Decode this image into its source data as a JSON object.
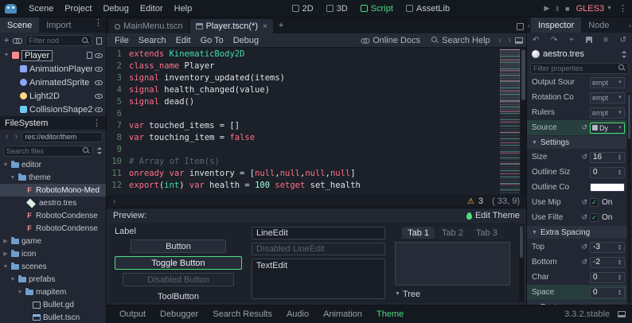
{
  "app": {
    "renderer": "GLES3",
    "version": "3.3.2.stable"
  },
  "colors": {
    "accent": "#4ade80",
    "warning": "#ffd153",
    "renderer_text": "#ff7e8d",
    "syntax": {
      "keyword": "#ff7085",
      "base_type": "#42ddb0",
      "number": "#a1ffe0",
      "comment": "#5b6574",
      "text": "#dfe3ea"
    }
  },
  "icons": {
    "dots_menu": "⋮",
    "add": "+",
    "chevron_left": "‹",
    "chevron_right": "›",
    "expander_open": "▼",
    "expander_closed": "▶",
    "dropdown_caret": "▼",
    "close": "×",
    "warning": "⚠",
    "check": "✓",
    "revert": "↺",
    "history_back": "↶",
    "history_forward": "↷",
    "menu": "≡",
    "play": "▶",
    "pause": "‖",
    "stop": "■",
    "spin_up": "▲",
    "spin_down": "▼"
  },
  "topbar": {
    "menus": [
      "Scene",
      "Project",
      "Debug",
      "Editor",
      "Help"
    ],
    "workspaces": [
      {
        "label": "2D",
        "active": false
      },
      {
        "label": "3D",
        "active": false
      },
      {
        "label": "Script",
        "active": true
      },
      {
        "label": "AssetLib",
        "active": false
      }
    ]
  },
  "scene_dock": {
    "tabs": [
      {
        "label": "Scene",
        "active": true
      },
      {
        "label": "Import",
        "active": false
      }
    ],
    "filter_placeholder": "Filter nod",
    "nodes": [
      {
        "name": "Player",
        "type": "kinematic-body2d",
        "color": "#fc8c8c",
        "indent": 0,
        "expander": true,
        "selected": true,
        "has_script": true,
        "eye": true,
        "round": false
      },
      {
        "name": "AnimationPlayer",
        "type": "animation-player",
        "color": "#8da5f3",
        "indent": 1,
        "expander": false,
        "selected": false,
        "has_script": false,
        "eye": true,
        "round": false
      },
      {
        "name": "AnimatedSprite",
        "type": "animated-sprite",
        "color": "#8da5f3",
        "indent": 1,
        "expander": false,
        "selected": false,
        "has_script": false,
        "eye": true,
        "round": true
      },
      {
        "name": "Light2D",
        "type": "light2d",
        "color": "#ffd97f",
        "indent": 1,
        "expander": false,
        "selected": false,
        "has_script": false,
        "eye": true,
        "round": true
      },
      {
        "name": "CollisionShape2D",
        "type": "collision-shape2d",
        "color": "#6fc9f0",
        "indent": 1,
        "expander": false,
        "selected": false,
        "has_script": false,
        "eye": true,
        "round": false
      }
    ]
  },
  "filesystem": {
    "title": "FileSystem",
    "path": "res://editor/them",
    "search_placeholder": "Search files",
    "items": [
      {
        "label": "editor",
        "icon": "folder",
        "expander": "open",
        "indent": 0,
        "selected": false
      },
      {
        "label": "theme",
        "icon": "folder",
        "expander": "open",
        "indent": 1,
        "selected": false
      },
      {
        "label": "RobotoMono-Med",
        "icon": "font",
        "expander": "",
        "indent": 2,
        "selected": true
      },
      {
        "label": "aestro.tres",
        "icon": "resource",
        "expander": "",
        "indent": 2,
        "selected": false
      },
      {
        "label": "RobotoCondense",
        "icon": "font",
        "expander": "",
        "indent": 2,
        "selected": false
      },
      {
        "label": "RobotoCondense",
        "icon": "font",
        "expander": "",
        "indent": 2,
        "selected": false
      },
      {
        "label": "game",
        "icon": "folder",
        "expander": "closed",
        "indent": 0,
        "selected": false
      },
      {
        "label": "icon",
        "icon": "folder",
        "expander": "closed",
        "indent": 0,
        "selected": false
      },
      {
        "label": "scenes",
        "icon": "folder",
        "expander": "open",
        "indent": 0,
        "selected": false
      },
      {
        "label": "prefabs",
        "icon": "folder",
        "expander": "open",
        "indent": 1,
        "selected": false
      },
      {
        "label": "mapitem",
        "icon": "folder",
        "expander": "open",
        "indent": 2,
        "selected": false
      },
      {
        "label": "Bullet.gd",
        "icon": "script",
        "expander": "",
        "indent": 3,
        "selected": false
      },
      {
        "label": "Bullet.tscn",
        "icon": "scene",
        "expander": "",
        "indent": 3,
        "selected": false
      }
    ]
  },
  "scene_tabs": {
    "tabs": [
      {
        "label": "MainMenu.tscn",
        "active": false
      },
      {
        "label": "Player.tscn(*)",
        "active": true
      }
    ]
  },
  "script_editor": {
    "menus": [
      "File",
      "Search",
      "Edit",
      "Go To",
      "Debug"
    ],
    "links": [
      {
        "label": "Online Docs"
      },
      {
        "label": "Search Help"
      }
    ],
    "status": {
      "warnings": "3",
      "caret": "( 33, 9)"
    },
    "code": [
      {
        "n": "1",
        "t": [
          [
            "k",
            "extends"
          ],
          [
            "p",
            " "
          ],
          [
            "c",
            "KinematicBody2D"
          ]
        ]
      },
      {
        "n": "2",
        "t": [
          [
            "k",
            "class_name"
          ],
          [
            "p",
            " Player"
          ]
        ]
      },
      {
        "n": "3",
        "t": [
          [
            "k",
            "signal"
          ],
          [
            "p",
            " inventory_updated(items)"
          ]
        ]
      },
      {
        "n": "4",
        "t": [
          [
            "k",
            "signal"
          ],
          [
            "p",
            " health_changed(value)"
          ]
        ]
      },
      {
        "n": "5",
        "t": [
          [
            "k",
            "signal"
          ],
          [
            "p",
            " dead()"
          ]
        ]
      },
      {
        "n": "6",
        "t": []
      },
      {
        "n": "7",
        "t": [
          [
            "k",
            "var"
          ],
          [
            "p",
            " touched_items = []"
          ]
        ]
      },
      {
        "n": "8",
        "t": [
          [
            "k",
            "var"
          ],
          [
            "p",
            " touching_item = "
          ],
          [
            "k",
            "false"
          ]
        ]
      },
      {
        "n": "9",
        "t": []
      },
      {
        "n": "10",
        "t": [
          [
            "m",
            "# Array of Item(s)"
          ]
        ]
      },
      {
        "n": "11",
        "t": [
          [
            "k",
            "onready"
          ],
          [
            "p",
            " "
          ],
          [
            "k",
            "var"
          ],
          [
            "p",
            " inventory = ["
          ],
          [
            "k",
            "null"
          ],
          [
            "p",
            ","
          ],
          [
            "k",
            "null"
          ],
          [
            "p",
            ","
          ],
          [
            "k",
            "null"
          ],
          [
            "p",
            ","
          ],
          [
            "k",
            "null"
          ],
          [
            "p",
            "]"
          ]
        ]
      },
      {
        "n": "12",
        "t": [
          [
            "k",
            "export"
          ],
          [
            "p",
            "("
          ],
          [
            "c",
            "int"
          ],
          [
            "p",
            ") "
          ],
          [
            "k",
            "var"
          ],
          [
            "p",
            " health = "
          ],
          [
            "n",
            "100"
          ],
          [
            "p",
            " "
          ],
          [
            "k",
            "setget"
          ],
          [
            "p",
            " set_health"
          ]
        ]
      }
    ]
  },
  "theme_preview": {
    "title": "Preview:",
    "edit_button": "Edit Theme",
    "label": "Label",
    "buttons": [
      "Button",
      "Toggle Button",
      "Disabled Button",
      "ToolButton"
    ],
    "line_edit": "LineEdit",
    "disabled_line_edit": "Disabled LineEdit",
    "text_edit": "TextEdit",
    "tabs": [
      "Tab 1",
      "Tab 2",
      "Tab 3"
    ],
    "tree_label": "Tree"
  },
  "bottom_bar": {
    "tabs": [
      {
        "label": "Output",
        "active": false
      },
      {
        "label": "Debugger",
        "active": false
      },
      {
        "label": "Search Results",
        "active": false
      },
      {
        "label": "Audio",
        "active": false
      },
      {
        "label": "Animation",
        "active": false
      },
      {
        "label": "Theme",
        "active": true
      }
    ],
    "version": "3.3.2.stable"
  },
  "inspector": {
    "tabs": [
      {
        "label": "Inspector",
        "active": true
      },
      {
        "label": "Node",
        "active": false
      }
    ],
    "resource": "aestro.tres",
    "filter_placeholder": "Filter properties",
    "rows": [
      {
        "kind": "dropdown",
        "label": "Output Sour",
        "value": "empt"
      },
      {
        "kind": "dropdown",
        "label": "Rotation Co",
        "value": "empt"
      },
      {
        "kind": "dropdown",
        "label": "Rulers",
        "value": "empt"
      },
      {
        "kind": "dropdown",
        "label": "Source",
        "value": "Dy",
        "revert": true,
        "highlight": true,
        "res_icon": true
      },
      {
        "kind": "section",
        "label": "Settings"
      },
      {
        "kind": "spin",
        "label": "Size",
        "value": "16",
        "revert": true
      },
      {
        "kind": "spin",
        "label": "Outline Siz",
        "value": "0"
      },
      {
        "kind": "color",
        "label": "Outline Co",
        "value": "#ffffff"
      },
      {
        "kind": "check",
        "label": "Use Mip",
        "value": "On",
        "revert": true
      },
      {
        "kind": "check",
        "label": "Use Filte",
        "value": "On",
        "revert": true
      },
      {
        "kind": "section",
        "label": "Extra Spacing"
      },
      {
        "kind": "spin",
        "label": "Top",
        "value": "-3",
        "revert": true
      },
      {
        "kind": "spin",
        "label": "Bottom",
        "value": "-2",
        "revert": true
      },
      {
        "kind": "spin",
        "label": "Char",
        "value": "0"
      },
      {
        "kind": "spin",
        "label": "Space",
        "value": "0",
        "selected": true
      },
      {
        "kind": "section",
        "label": "Font"
      }
    ]
  }
}
